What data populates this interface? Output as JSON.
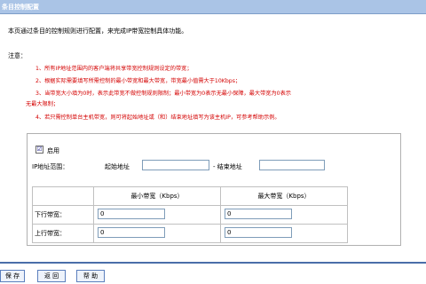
{
  "title": "条目控制配置",
  "intro": "本页通过条目的控制规则进行配置，来完成IP带宽控制具体功能。",
  "notes": {
    "label": "注意：",
    "items": [
      "1、所有IP地址范围内的客户端将共享带宽控制规则设定的带宽；",
      "2、根据实际需要填写所需控制的最小带宽和最大带宽，带宽最小值需大于10Kbps；",
      "3、当带宽大小填为0时，表示此带宽不做控制规则限制；最小带宽为0表示无最小保障，最大带宽为0表示",
      "无最大限制；",
      "4、若只需控制单台主机带宽，则可将起始地址或（和）结束地址填写为该主机IP，可参考帮助示例。"
    ]
  },
  "form": {
    "enable_checked": "☑",
    "enable_label": "启用",
    "ip_range_label": "IP地址范围：",
    "start_label": "起始地址",
    "start_value": "",
    "end_label": "- 结束地址",
    "end_value": "",
    "table": {
      "headers": [
        "最小带宽（Kbps）",
        "最大带宽（Kbps）"
      ],
      "rows": [
        {
          "label": "下行带宽：",
          "min": "0",
          "max": "0"
        },
        {
          "label": "上行带宽：",
          "min": "0",
          "max": "0"
        }
      ]
    }
  },
  "buttons": {
    "save": "保 存",
    "back": "返 回",
    "help": "帮 助"
  },
  "colors": {
    "title_bar": "#aac4e6",
    "notes_text": "#d40000",
    "button_border": "#5b7fbd"
  }
}
